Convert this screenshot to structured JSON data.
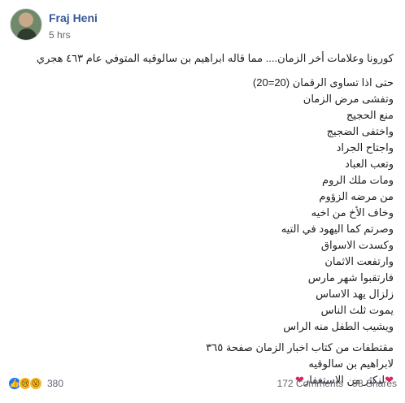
{
  "header": {
    "author": "Fraj Heni",
    "time": "5 hrs"
  },
  "post": {
    "lead": "كورونا وعلامات أخر الزمان.... مما قاله ابراهيم بن سالوقيه المتوفي عام ٤٦٣ هجري",
    "lines": [
      "حتى اذا تساوى الرقمان (20=20)",
      "وتفشى مرض الزمان",
      "منع الحجيج",
      "واختفى الضجيج",
      "واجتاح الجراد",
      "وتعب العباد",
      "ومات ملك الروم",
      "من مرضه الزؤوم",
      "وخاف الأخ من اخيه",
      "وصرتم كما اليهود في التيه",
      "وكسدت الاسواق",
      "وارتفعت الاثمان",
      "فارتقبوا شهر مارس",
      "زلزال يهد الاساس",
      "يموت ثلث الناس",
      "ويشيب الطفل منه الراس"
    ],
    "source": [
      "مقتطفات من كتاب اخبار الزمان صفحة ٣٦٥",
      "لابراهيم بن سالوقيه"
    ],
    "closing": "لنكثر من الاستغفار"
  },
  "footer": {
    "reaction_icons": [
      "like-icon",
      "sad-icon",
      "wow-icon"
    ],
    "reaction_count": "380",
    "comments": "172 Comments",
    "shares": "98 Shares"
  }
}
